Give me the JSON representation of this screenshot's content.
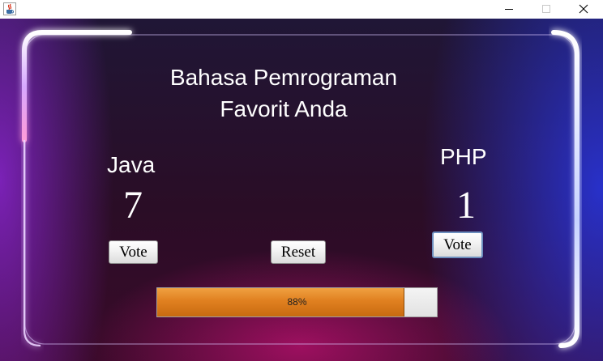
{
  "window": {
    "icons": {
      "app": "java-cup-icon",
      "minimize": "minimize-icon",
      "maximize": "maximize-icon",
      "close": "close-icon"
    }
  },
  "header": {
    "title_line1": "Bahasa Pemrograman",
    "title_line2": "Favorit Anda"
  },
  "left": {
    "language": "Java",
    "votes": "7",
    "vote_label": "Vote"
  },
  "right": {
    "language": "PHP",
    "votes": "1",
    "vote_label": "Vote"
  },
  "reset_label": "Reset",
  "progress": {
    "value": 88,
    "text": "88%"
  },
  "colors": {
    "neon_left": "#b46cff",
    "neon_right": "#5a7bff",
    "neon_bottom": "#ff2f9a",
    "progress_fill": "#e08020"
  }
}
